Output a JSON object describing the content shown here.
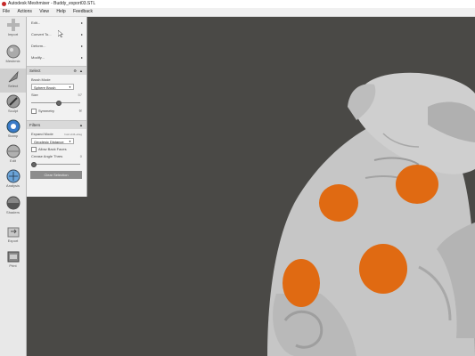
{
  "window": {
    "title": "Autodesk Meshmixer - Buddy_export03.STL"
  },
  "menubar": [
    "File",
    "Actions",
    "View",
    "Help",
    "Feedback"
  ],
  "toolbar": [
    {
      "label": "Import",
      "icon": "plus-icon"
    },
    {
      "label": "Meshmix",
      "icon": "meshmix-sphere-icon"
    },
    {
      "label": "Select",
      "icon": "select-arrow-icon"
    },
    {
      "label": "Sculpt",
      "icon": "sculpt-brush-icon"
    },
    {
      "label": "Stamp",
      "icon": "stamp-icon"
    },
    {
      "label": "Edit",
      "icon": "edit-sphere-icon"
    },
    {
      "label": "Analysis",
      "icon": "analysis-sphere-icon"
    },
    {
      "label": "Shaders",
      "icon": "shaders-sphere-icon"
    },
    {
      "label": "Export",
      "icon": "export-icon"
    },
    {
      "label": "Print",
      "icon": "print-icon"
    }
  ],
  "panel": {
    "menu_items": [
      {
        "label": "Edit..."
      },
      {
        "label": "Convert To..."
      },
      {
        "label": "Deform..."
      },
      {
        "label": "Modify..."
      }
    ],
    "select": {
      "header": "Select",
      "brush_mode_label": "Brush Mode",
      "brush_mode_value": "Sphere Brush",
      "size_label": "Size",
      "size_value": "57",
      "size_fraction": 0.57,
      "symmetry_label": "Symmetry"
    },
    "filters": {
      "header": "Filters",
      "expand_mode_label": "Expand Mode",
      "expand_mode_hint": "hold shift+drag",
      "expand_mode_value": "Geodesic Distance",
      "allow_back_faces_label": "Allow Back Faces",
      "crease_angle_label": "Crease Angle Thres",
      "crease_angle_value": "0",
      "crease_angle_fraction": 0.0
    },
    "clear_selection_label": "Clear Selection"
  },
  "colors": {
    "viewport_bg": "#4a4946",
    "model": "#c8c8c8",
    "selection": "#e06a12",
    "panel_bg": "#f2f2f2"
  }
}
